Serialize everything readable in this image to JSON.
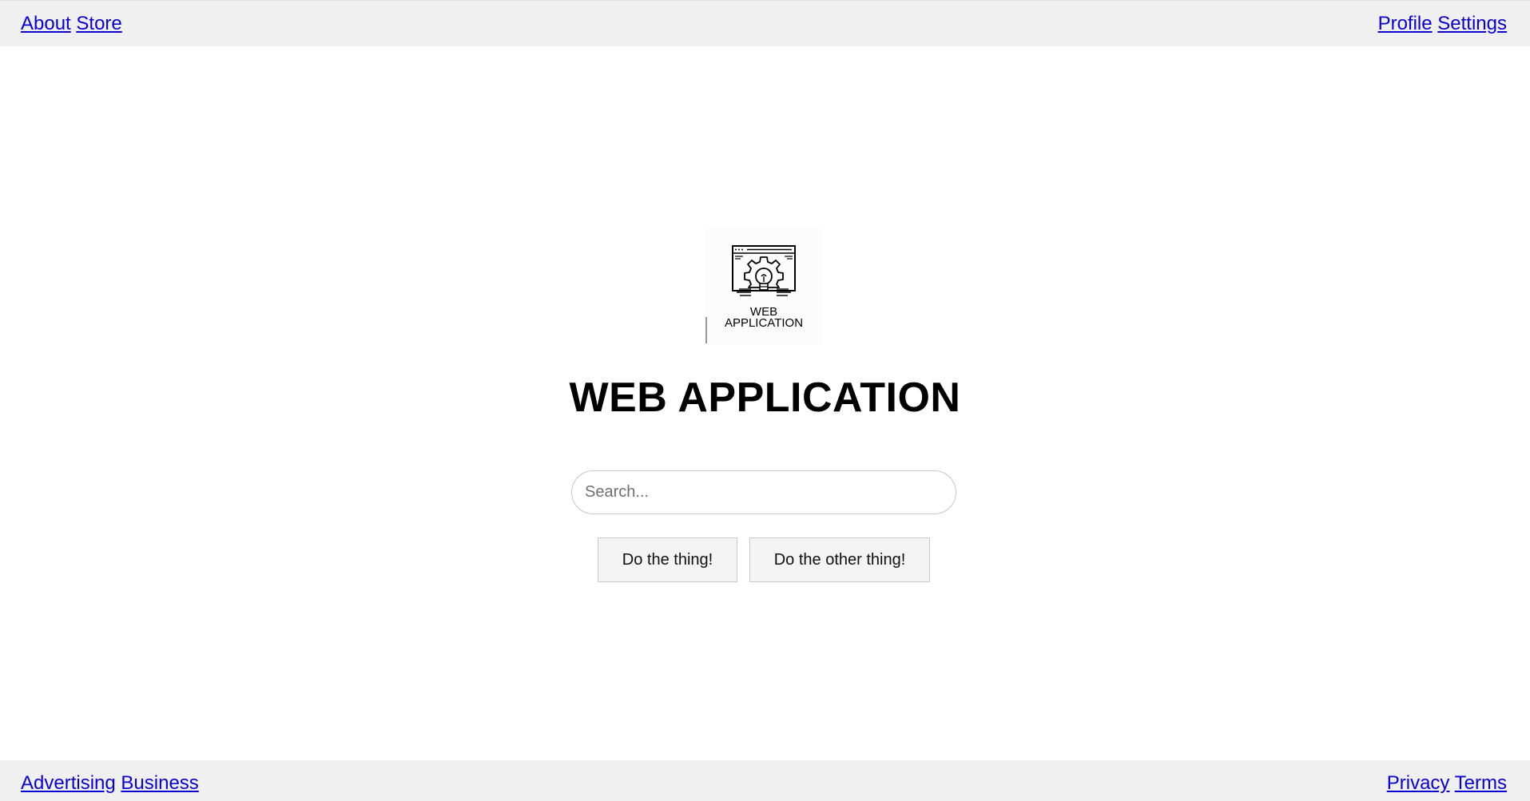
{
  "header": {
    "left_links": [
      "About",
      "Store"
    ],
    "right_links": [
      "Profile",
      "Settings"
    ]
  },
  "logo": {
    "icon": "web-application-gear-icon",
    "text_line1": "WEB",
    "text_line2": "APPLICATION"
  },
  "main": {
    "title": "WEB APPLICATION",
    "search": {
      "placeholder": "Search...",
      "value": ""
    },
    "buttons": [
      "Do the thing!",
      "Do the other thing!"
    ]
  },
  "footer": {
    "left_links": [
      "Advertising",
      "Business"
    ],
    "right_links": [
      "Privacy",
      "Terms"
    ]
  },
  "colors": {
    "link": "#0b00d4",
    "bar_background": "#f0f0f0"
  }
}
